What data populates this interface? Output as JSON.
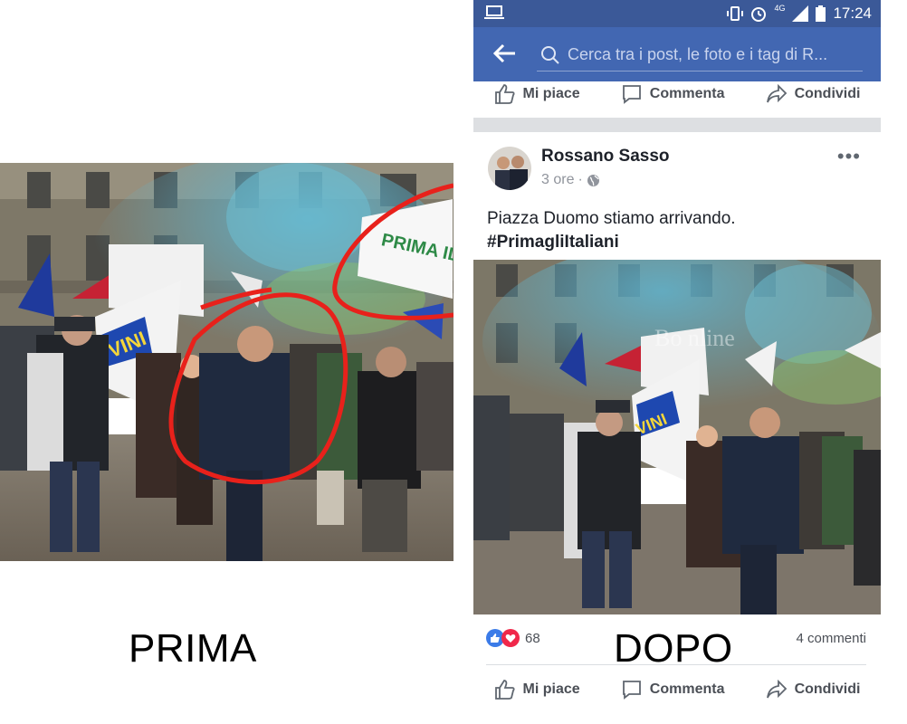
{
  "captions": {
    "before": "PRIMA",
    "after": "DOPO"
  },
  "status_bar": {
    "network": "4G",
    "time": "17:24"
  },
  "search": {
    "placeholder": "Cerca tra i post, le foto e i tag di R..."
  },
  "actions": {
    "like": "Mi piace",
    "comment": "Commenta",
    "share": "Condividi"
  },
  "post": {
    "author": "Rossano Sasso",
    "time": "3 ore",
    "privacy_icon": "globe-icon",
    "text": "Piazza Duomo stiamo arrivando.",
    "hashtag": "#PrimagliItaliani",
    "reactions_count": "68",
    "comments": "4 commenti"
  },
  "flags": {
    "left_banner": "PRIMA IL NO",
    "left_flag": "VINI",
    "right_flag": "VINI"
  },
  "watermark": "Bo  nline",
  "colors": {
    "fb_blue": "#4267b2",
    "fb_dark": "#3b5998",
    "annotation_red": "#e8211b",
    "smoke_blue": "#5aa8c8"
  }
}
